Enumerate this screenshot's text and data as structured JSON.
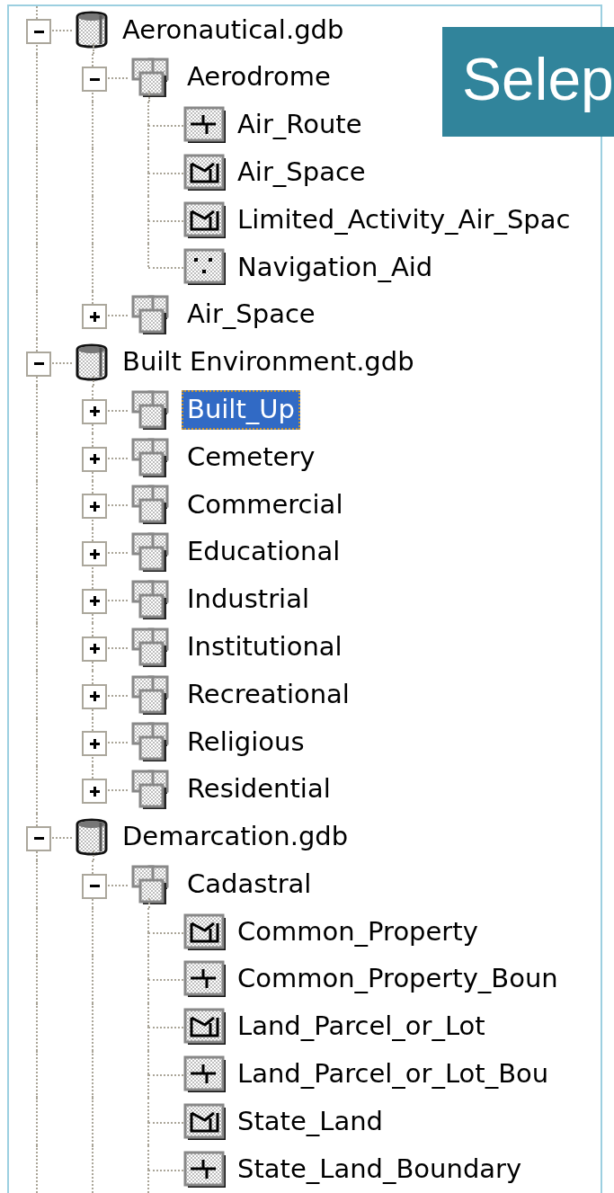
{
  "tree": [
    {
      "label": "Aeronautical.gdb",
      "kind": "database",
      "expanded": true,
      "selected": false,
      "children": [
        {
          "label": "Aerodrome",
          "kind": "dataset",
          "expanded": true,
          "selected": false,
          "children": [
            {
              "label": "Air_Route",
              "kind": "line",
              "selected": false
            },
            {
              "label": "Air_Space",
              "kind": "polygon",
              "selected": false
            },
            {
              "label": "Limited_Activity_Air_Spac",
              "kind": "polygon",
              "selected": false
            },
            {
              "label": "Navigation_Aid",
              "kind": "point",
              "selected": false
            }
          ]
        },
        {
          "label": "Air_Space",
          "kind": "dataset",
          "expanded": false,
          "selected": false
        }
      ]
    },
    {
      "label": "Built Environment.gdb",
      "kind": "database",
      "expanded": true,
      "selected": false,
      "children": [
        {
          "label": "Built_Up",
          "kind": "dataset",
          "expanded": false,
          "selected": true
        },
        {
          "label": "Cemetery",
          "kind": "dataset",
          "expanded": false,
          "selected": false
        },
        {
          "label": "Commercial",
          "kind": "dataset",
          "expanded": false,
          "selected": false
        },
        {
          "label": "Educational",
          "kind": "dataset",
          "expanded": false,
          "selected": false
        },
        {
          "label": "Industrial",
          "kind": "dataset",
          "expanded": false,
          "selected": false
        },
        {
          "label": "Institutional",
          "kind": "dataset",
          "expanded": false,
          "selected": false
        },
        {
          "label": "Recreational",
          "kind": "dataset",
          "expanded": false,
          "selected": false
        },
        {
          "label": "Religious",
          "kind": "dataset",
          "expanded": false,
          "selected": false
        },
        {
          "label": "Residential",
          "kind": "dataset",
          "expanded": false,
          "selected": false
        }
      ]
    },
    {
      "label": "Demarcation.gdb",
      "kind": "database",
      "expanded": true,
      "selected": false,
      "children": [
        {
          "label": "Cadastral",
          "kind": "dataset",
          "expanded": true,
          "selected": false,
          "children": [
            {
              "label": "Common_Property",
              "kind": "polygon",
              "selected": false
            },
            {
              "label": "Common_Property_Boun",
              "kind": "line",
              "selected": false
            },
            {
              "label": "Land_Parcel_or_Lot",
              "kind": "polygon",
              "selected": false
            },
            {
              "label": "Land_Parcel_or_Lot_Bou",
              "kind": "line",
              "selected": false
            },
            {
              "label": "State_Land",
              "kind": "polygon",
              "selected": false
            },
            {
              "label": "State_Land_Boundary",
              "kind": "line",
              "selected": false
            }
          ]
        }
      ]
    }
  ],
  "slide_title": "Selep"
}
